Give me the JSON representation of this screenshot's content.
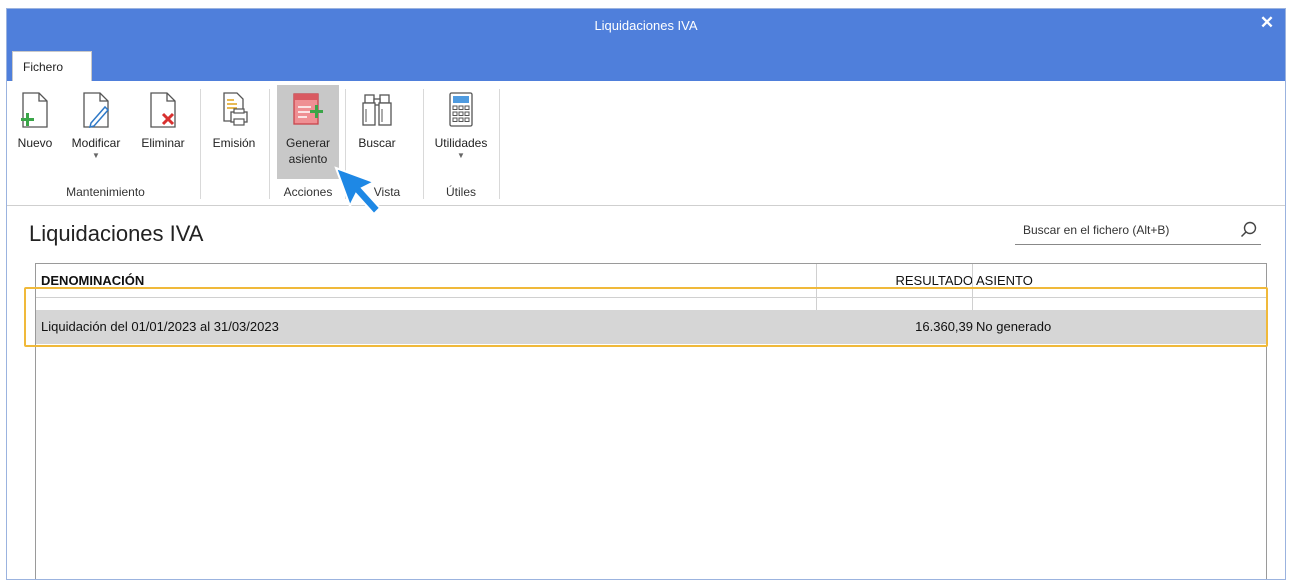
{
  "window": {
    "title": "Liquidaciones IVA",
    "close_glyph": "✕"
  },
  "tabs": [
    {
      "label": "Fichero"
    }
  ],
  "ribbon": {
    "buttons": [
      {
        "label": "Nuevo",
        "icon": "new-document-icon"
      },
      {
        "label": "Modificar",
        "icon": "edit-document-icon",
        "dropdown": true
      },
      {
        "label": "Eliminar",
        "icon": "delete-document-icon"
      },
      {
        "label": "Emisión",
        "icon": "print-document-icon"
      },
      {
        "label_line1": "Generar",
        "label_line2": "asiento",
        "icon": "generate-entry-icon",
        "active": true
      },
      {
        "label": "Buscar",
        "icon": "binoculars-icon"
      },
      {
        "label": "Utilidades",
        "icon": "calculator-icon",
        "dropdown": true
      }
    ],
    "groups": [
      {
        "label": "Mantenimiento"
      },
      {
        "label": "Acciones"
      },
      {
        "label": "Vista"
      },
      {
        "label": "Útiles"
      }
    ]
  },
  "main": {
    "title": "Liquidaciones IVA",
    "search": {
      "placeholder": "Buscar en el fichero (Alt+B)"
    }
  },
  "table": {
    "columns": [
      "DENOMINACIÓN",
      "RESULTADO",
      "ASIENTO"
    ],
    "rows": [
      {
        "denominacion": "Liquidación del 01/01/2023 al 31/03/2023",
        "resultado": "16.360,39",
        "asiento": "No generado"
      }
    ]
  },
  "colors": {
    "accent": "#4f7fdb",
    "highlight": "#f0b93a",
    "selected_row": "#d6d6d6",
    "cursor": "#1e88e5"
  }
}
